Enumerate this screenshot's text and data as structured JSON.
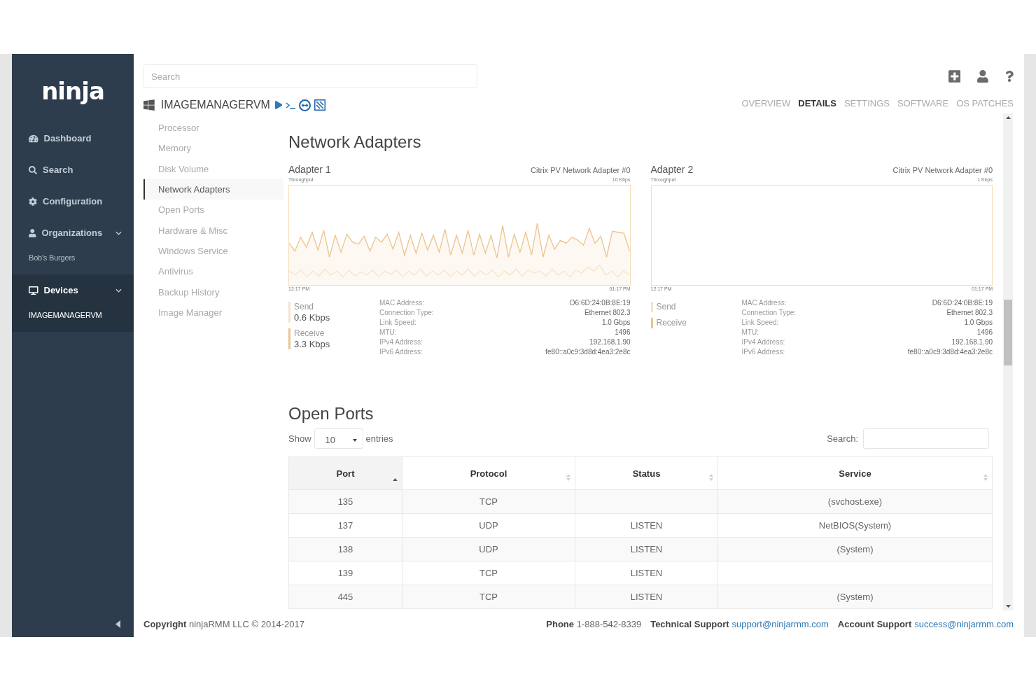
{
  "sidebar": {
    "logo": "ninja",
    "items": [
      {
        "label": "Dashboard",
        "selected": false
      },
      {
        "label": "Search",
        "selected": false
      },
      {
        "label": "Configuration",
        "selected": false
      },
      {
        "label": "Organizations",
        "selected": false,
        "expanded": true,
        "children": [
          {
            "label": "Bob's Burgers",
            "selected": false
          }
        ]
      },
      {
        "label": "Devices",
        "selected": true,
        "expanded": true,
        "children": [
          {
            "label": "IMAGEMANAGERVM",
            "selected": true
          }
        ]
      }
    ]
  },
  "search": {
    "placeholder": "Search"
  },
  "device": {
    "name": "IMAGEMANAGERVM"
  },
  "tabs": [
    {
      "label": "OVERVIEW",
      "selected": false
    },
    {
      "label": "DETAILS",
      "selected": true
    },
    {
      "label": "SETTINGS",
      "selected": false
    },
    {
      "label": "SOFTWARE",
      "selected": false
    },
    {
      "label": "OS PATCHES",
      "selected": false
    }
  ],
  "detail_nav": [
    {
      "label": "Processor",
      "selected": false
    },
    {
      "label": "Memory",
      "selected": false
    },
    {
      "label": "Disk Volume",
      "selected": false
    },
    {
      "label": "Network Adapters",
      "selected": true
    },
    {
      "label": "Open Ports",
      "selected": false
    },
    {
      "label": "Hardware & Misc",
      "selected": false
    },
    {
      "label": "Windows Service",
      "selected": false
    },
    {
      "label": "Antivirus",
      "selected": false
    },
    {
      "label": "Backup History",
      "selected": false
    },
    {
      "label": "Image Manager",
      "selected": false
    }
  ],
  "network_adapters": {
    "title": "Network Adapters",
    "adapters": [
      {
        "name": "Adapter 1",
        "model": "Citrix PV Network Adapter #0",
        "graph_label": "Throughput",
        "scale": "10 Kbps",
        "traffic": true,
        "start_time": "12:17 PM",
        "end_time": "01:17 PM",
        "legend": [
          {
            "label": "Send",
            "value": "0.6 Kbps",
            "color": "#f5e4cc"
          },
          {
            "label": "Receive",
            "value": "3.3 Kbps",
            "color": "#ebc48f"
          }
        ],
        "details": [
          {
            "label": "MAC Address:",
            "value": "D6:6D:24:0B:8E:19"
          },
          {
            "label": "Connection Type:",
            "value": "Ethernet 802.3"
          },
          {
            "label": "Link Speed:",
            "value": "1.0 Gbps"
          },
          {
            "label": "MTU:",
            "value": "1496"
          },
          {
            "label": "IPv4 Address:",
            "value": "192.168.1.90"
          },
          {
            "label": "IPv6 Address:",
            "value": "fe80::a0c9:3d8d:4ea3:2e8c"
          }
        ]
      },
      {
        "name": "Adapter 2",
        "model": "Citrix PV Network Adapter #0",
        "graph_label": "Throughput",
        "scale": "1 Kbps",
        "traffic": false,
        "start_time": "12:17 PM",
        "end_time": "01:17 PM",
        "legend": [
          {
            "label": "Send",
            "color": "#f5e4cc"
          },
          {
            "label": "Receive",
            "color": "#ebc48f"
          }
        ],
        "details": [
          {
            "label": "MAC Address:",
            "value": "D6:6D:24:0B:8E:19"
          },
          {
            "label": "Connection Type:",
            "value": "Ethernet 802.3"
          },
          {
            "label": "Link Speed:",
            "value": "1.0 Gbps"
          },
          {
            "label": "MTU:",
            "value": "1496"
          },
          {
            "label": "IPv4 Address:",
            "value": "192.168.1.90"
          },
          {
            "label": "IPv6 Address:",
            "value": "fe80::a0c9:3d8d:4ea3:2e8c"
          }
        ]
      }
    ]
  },
  "open_ports": {
    "title": "Open Ports",
    "show_label": "Show",
    "page_size": "10",
    "entries_label": "entries",
    "search_label": "Search:",
    "columns": [
      {
        "label": "Port",
        "sorted": true
      },
      {
        "label": "Protocol",
        "sorted": false
      },
      {
        "label": "Status",
        "sorted": false
      },
      {
        "label": "Service",
        "sorted": false
      }
    ],
    "rows": [
      {
        "port": "135",
        "protocol": "TCP",
        "service": "(svchost.exe)"
      },
      {
        "port": "137",
        "protocol": "UDP",
        "status": "LISTEN",
        "service": "NetBIOS(System)"
      },
      {
        "port": "138",
        "protocol": "UDP",
        "status": "LISTEN",
        "service": "(System)"
      },
      {
        "port": "139",
        "protocol": "TCP",
        "status": "LISTEN"
      },
      {
        "port": "445",
        "protocol": "TCP",
        "status": "LISTEN",
        "service": "(System)"
      }
    ]
  },
  "footer": {
    "copyright": "**Copyright** ninjaRMM LLC © 2014-2017",
    "phone": "**Phone** 1-888-542-8339",
    "contacts": [
      {
        "label": "Technical Support",
        "email": "support@ninjarmm.com"
      },
      {
        "label": "Account Support",
        "email": "success@ninjarmm.com"
      }
    ]
  }
}
